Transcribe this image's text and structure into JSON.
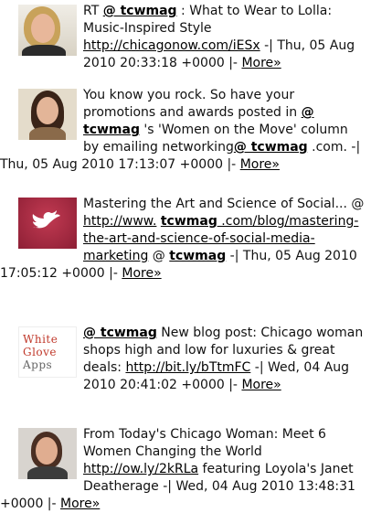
{
  "tweets": [
    {
      "avatar": "woman-portrait-blonde",
      "prefix": "RT ",
      "user": "@ tcwmag",
      "text1": " : What to Wear to Lolla: Music-Inspired Style ",
      "link": "http://chicagonow.com/iESx",
      "text2": " -| Thu, 05 Aug 2010 20:33:18 +0000 |- ",
      "more": "More»"
    },
    {
      "avatar": "woman-portrait-brunette",
      "prefix": "You know you rock. So have your promotions and awards posted in ",
      "user": "@ tcwmag",
      "text1": " 's 'Women on the Move' column by emailing networking",
      "link": "@ tcwmag",
      "text2": " .com. -| Thu, 05 Aug 2010 17:13:07 +0000 |- ",
      "more": "More»"
    },
    {
      "avatar": "twitter-bird-icon",
      "prefix": "Mastering the Art and Science of Social... @ ",
      "link": "http://www.",
      "user": "tcwmag",
      "link2": " .com/blog/mastering-the-art-and-science-of-social-media-marketing",
      "text1": " @ ",
      "user2": "tcwmag",
      "text2": " -| Thu, 05 Aug 2010 17:05:12 +0000 |- ",
      "more": "More»"
    },
    {
      "avatar": "white-glove-apps-logo",
      "logo_lines": [
        "White",
        "Glove",
        "Apps"
      ],
      "user": "@ tcwmag",
      "text1": " New blog post: Chicago woman shops high and low for luxuries & great deals: ",
      "link": "http://bit.ly/bTtmFC",
      "text2": " -| Wed, 04 Aug 2010 20:41:02 +0000 |- ",
      "more": "More»"
    },
    {
      "avatar": "woman-portrait-dark-hair",
      "prefix": "From Today's Chicago Woman: Meet 6 Women Changing the World ",
      "link": "http://ow.ly/2kRLa",
      "text1": " featuring Loyola's Janet Deatherage -| Wed, 04 Aug 2010 13:48:31 +0000 |- ",
      "more": "More»"
    }
  ]
}
